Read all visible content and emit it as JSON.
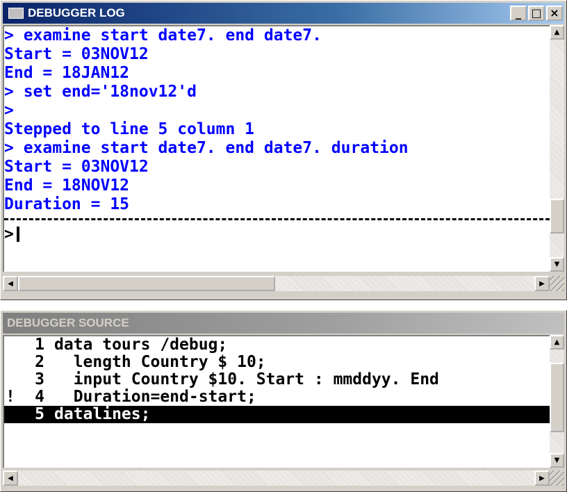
{
  "log_window": {
    "title": "DEBUGGER LOG",
    "lines": [
      "> examine start date7. end date7.",
      "Start = 03NOV12",
      "End = 18JAN12",
      "> set end='18nov12'd",
      ">",
      "Stepped to line 5 column 1",
      "> examine start date7. end date7. duration",
      "Start = 03NOV12",
      "End = 18NOV12",
      "Duration = 15"
    ],
    "prompt": ">",
    "command_value": ""
  },
  "source_window": {
    "title": "DEBUGGER SOURCE",
    "lines": [
      {
        "flag": "",
        "num": "1",
        "code": "data tours /debug;"
      },
      {
        "flag": "",
        "num": "2",
        "code": "  length Country $ 10;"
      },
      {
        "flag": "",
        "num": "3",
        "code": "  input Country $10. Start : mmddyy. End"
      },
      {
        "flag": "!",
        "num": "4",
        "code": "  Duration=end-start;"
      },
      {
        "flag": "",
        "num": "5",
        "code": "datalines;"
      }
    ],
    "current_line": "5"
  },
  "caption_buttons": {
    "minimize": "_",
    "maximize": "□",
    "close": "×"
  },
  "icons": {
    "up": "arrow-up-icon",
    "down": "arrow-down-icon",
    "left": "arrow-left-icon",
    "right": "arrow-right-icon"
  },
  "colors": {
    "log_text": "#0000ff",
    "active_title": "#0a246a",
    "inactive_title": "#808080",
    "highlight": "#000000"
  }
}
